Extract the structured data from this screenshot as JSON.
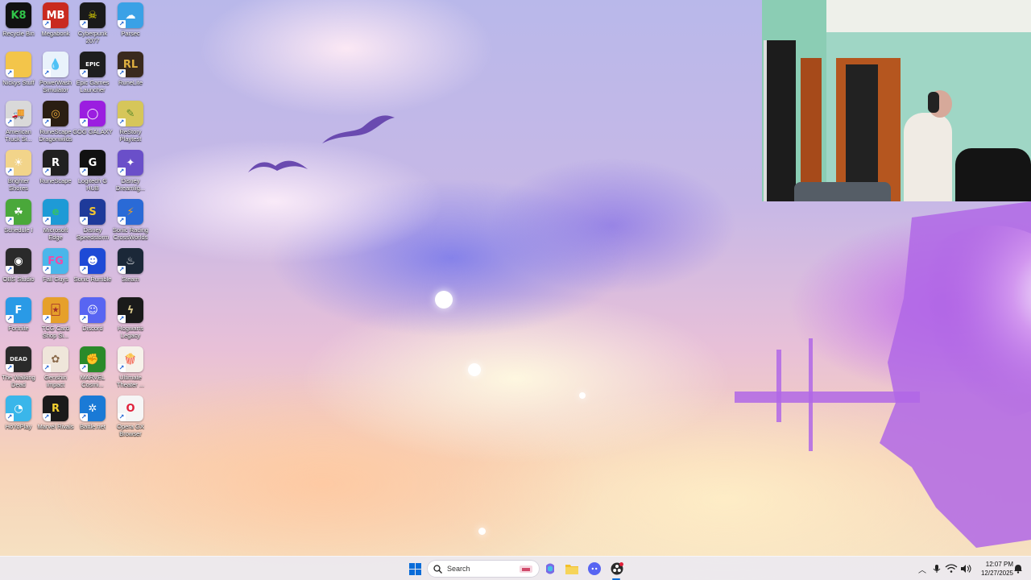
{
  "desktop": {
    "icons": [
      {
        "label": "Recycle Bin",
        "icon": "recycle-bin-icon",
        "glyph": "K8",
        "color": "#111111",
        "accent": "#31c54a"
      },
      {
        "label": "Megabonk",
        "icon": "megabonk-icon",
        "glyph": "MB",
        "color": "#c92a1f",
        "accent": "#ffffff"
      },
      {
        "label": "Cyberpunk 2077",
        "icon": "cyberpunk-icon",
        "glyph": "☠",
        "color": "#1a1a1a",
        "accent": "#f3e600"
      },
      {
        "label": "Parsec",
        "icon": "parsec-icon",
        "glyph": "☁",
        "color": "#3aa1e6",
        "accent": "#ffffff"
      },
      {
        "label": "Nickys Stuff",
        "icon": "folder-icon",
        "glyph": "",
        "color": "#f3c54a",
        "accent": "#ffffff"
      },
      {
        "label": "PowerWash Simulator",
        "icon": "powerwash-icon",
        "glyph": "💧",
        "color": "#e9f2fb",
        "accent": "#2d7ad8"
      },
      {
        "label": "Epic Games Launcher",
        "icon": "epic-games-icon",
        "glyph": "EPIC",
        "color": "#1e1e1e",
        "accent": "#ffffff"
      },
      {
        "label": "RuneLite",
        "icon": "runelite-icon",
        "glyph": "RL",
        "color": "#3a2a1e",
        "accent": "#e0b040"
      },
      {
        "label": "American Truck Si...",
        "icon": "american-truck-icon",
        "glyph": "🚚",
        "color": "#d9d9d9",
        "accent": "#c0302a"
      },
      {
        "label": "RuneScape Dragonwilds",
        "icon": "dragonwilds-icon",
        "glyph": "◎",
        "color": "#2a1e12",
        "accent": "#e9a93a"
      },
      {
        "label": "GOG GALAXY",
        "icon": "gog-galaxy-icon",
        "glyph": "◯",
        "color": "#9b1ee0",
        "accent": "#ffffff"
      },
      {
        "label": "ReStory Playtest",
        "icon": "restory-icon",
        "glyph": "✎",
        "color": "#d6c65a",
        "accent": "#5a8a2a"
      },
      {
        "label": "Brighter Shores",
        "icon": "brighter-shores-icon",
        "glyph": "☀",
        "color": "#f2d48a",
        "accent": "#ffffff"
      },
      {
        "label": "RuneScape",
        "icon": "runescape-icon",
        "glyph": "R",
        "color": "#202020",
        "accent": "#ffffff"
      },
      {
        "label": "Logitech G HUB",
        "icon": "logitech-ghub-icon",
        "glyph": "G",
        "color": "#111111",
        "accent": "#ffffff"
      },
      {
        "label": "Disney Dreamlig...",
        "icon": "disney-dreamlight-icon",
        "glyph": "✦",
        "color": "#6a4fc9",
        "accent": "#ffffff"
      },
      {
        "label": "Schedule I",
        "icon": "schedule-one-icon",
        "glyph": "☘",
        "color": "#4aa83a",
        "accent": "#ffffff"
      },
      {
        "label": "Microsoft Edge",
        "icon": "edge-icon",
        "glyph": "e",
        "color": "#1e9ad6",
        "accent": "#34c06a"
      },
      {
        "label": "Disney Speedstorm",
        "icon": "speedstorm-icon",
        "glyph": "S",
        "color": "#1e3a9a",
        "accent": "#f3c530"
      },
      {
        "label": "Sonic Racing CrossWorlds",
        "icon": "sonic-racing-icon",
        "glyph": "⚡",
        "color": "#2a6ad6",
        "accent": "#f3a020"
      },
      {
        "label": "OBS Studio",
        "icon": "obs-studio-icon",
        "glyph": "◉",
        "color": "#2a2a2a",
        "accent": "#ffffff"
      },
      {
        "label": "Fall Guys",
        "icon": "fall-guys-icon",
        "glyph": "FG",
        "color": "#4ab6ea",
        "accent": "#f04aa6"
      },
      {
        "label": "Sonic Rumble",
        "icon": "sonic-rumble-icon",
        "glyph": "☻",
        "color": "#1e4ad6",
        "accent": "#ffffff"
      },
      {
        "label": "Steam",
        "icon": "steam-icon",
        "glyph": "♨",
        "color": "#1b2838",
        "accent": "#ffffff"
      },
      {
        "label": "Fortnite",
        "icon": "fortnite-icon",
        "glyph": "F",
        "color": "#2a9ae6",
        "accent": "#ffffff"
      },
      {
        "label": "TCG Card Shop Si...",
        "icon": "tcg-card-shop-icon",
        "glyph": "🃏",
        "color": "#e6a02a",
        "accent": "#a02a2a"
      },
      {
        "label": "Discord",
        "icon": "discord-icon",
        "glyph": "☺",
        "color": "#5865f2",
        "accent": "#ffffff"
      },
      {
        "label": "Hogwarts Legacy",
        "icon": "hogwarts-legacy-icon",
        "glyph": "ϟ",
        "color": "#1a1a1a",
        "accent": "#d6c68a"
      },
      {
        "label": "The Walking Dead",
        "icon": "walking-dead-icon",
        "glyph": "DEAD",
        "color": "#2a2a2a",
        "accent": "#e6e6e6"
      },
      {
        "label": "Genshin Impact",
        "icon": "genshin-impact-icon",
        "glyph": "✿",
        "color": "#efe6da",
        "accent": "#8a6a4a"
      },
      {
        "label": "MARVEL Cosmi...",
        "icon": "marvel-cosmic-icon",
        "glyph": "✊",
        "color": "#2a8a2a",
        "accent": "#f3e6a0"
      },
      {
        "label": "Ultimate Theater ...",
        "icon": "ultimate-theater-icon",
        "glyph": "🍿",
        "color": "#f6f2ea",
        "accent": "#c0302a"
      },
      {
        "label": "HoYoPlay",
        "icon": "hoyoplay-icon",
        "glyph": "◔",
        "color": "#3ab6ea",
        "accent": "#ffffff"
      },
      {
        "label": "Marvel Rivals",
        "icon": "marvel-rivals-icon",
        "glyph": "R",
        "color": "#1a1a1a",
        "accent": "#f3d030"
      },
      {
        "label": "Battle.net",
        "icon": "battlenet-icon",
        "glyph": "✲",
        "color": "#1a7ad6",
        "accent": "#ffffff"
      },
      {
        "label": "Opera GX Browser",
        "icon": "opera-gx-icon",
        "glyph": "O",
        "color": "#f6f6f6",
        "accent": "#e0203a"
      }
    ]
  },
  "taskbar": {
    "search_placeholder": "Search",
    "apps": [
      {
        "name": "copilot-icon",
        "color": "#7a6ae6"
      },
      {
        "name": "file-explorer-icon",
        "color": "#f3c02a"
      },
      {
        "name": "discord-taskbar-icon",
        "color": "#5865f2"
      },
      {
        "name": "obs-taskbar-icon",
        "color": "#2a2a2a"
      }
    ],
    "tray": {
      "time": "12:07 PM",
      "date": "12/27/2025"
    }
  },
  "colors": {
    "taskbar_bg": "#ece9f0",
    "windows_blue": "#0a6cd8"
  }
}
